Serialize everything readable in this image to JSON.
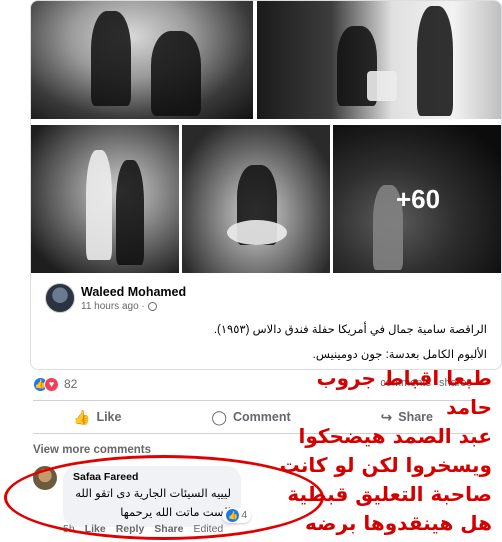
{
  "shared_post": {
    "photos_more_count": "+60",
    "author": {
      "name": "Waleed Mohamed",
      "time": "11 hours ago · "
    },
    "caption_line1": "الراقصة سامية جمال في أمريكا حفلة فندق دالاس (١٩٥٣).",
    "caption_line2": "الألبوم الكامل بعدسة: جون دومينيس."
  },
  "stats": {
    "reaction_count": "82",
    "comments": "comments",
    "shares": "shares"
  },
  "actions": {
    "like": "Like",
    "comment": "Comment",
    "share": "Share"
  },
  "view_more": "View more comments",
  "comment": {
    "name": "Safaa Fareed",
    "text_line1": "ليييه السيئات الجارية دى اتقو الله",
    "text_line2": "الست ماتت الله يرحمها",
    "like_count": "4",
    "time": "5h",
    "like": "Like",
    "reply": "Reply",
    "share": "Share",
    "edited": "Edited"
  },
  "annotation": {
    "line1": "طبعا اقباط جروب حامد",
    "line2": "عبد الصمد هيضحكوا",
    "line3": "ويسخروا لكن لو كانت",
    "line4": "صاحبة التعليق قبطية",
    "line5": "هل هينقدوها برضه",
    "color": "#d40000"
  },
  "colors": {
    "accent": "#1877f2",
    "love": "#f33e58",
    "muted_text": "#65676b"
  }
}
